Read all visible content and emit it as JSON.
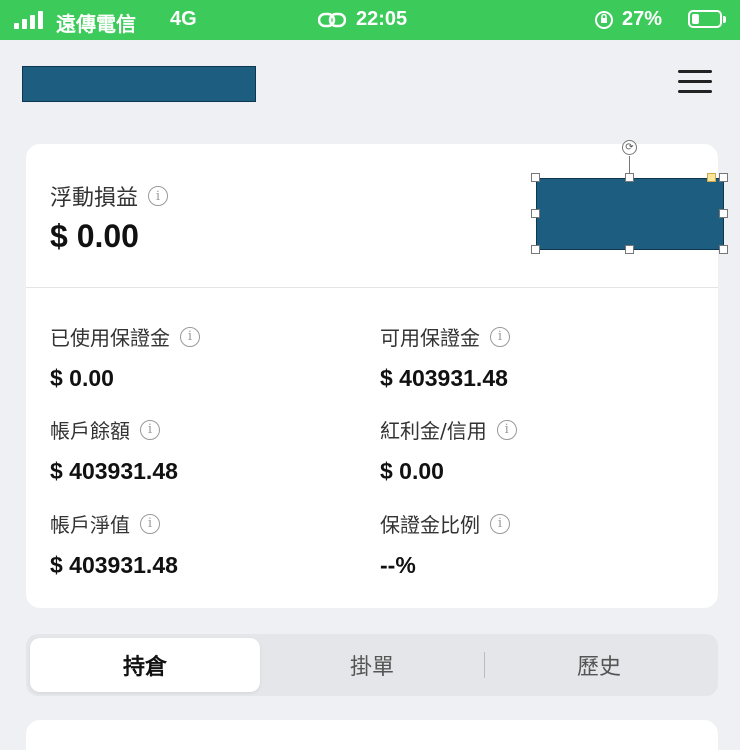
{
  "status_bar": {
    "carrier": "遠傳電信",
    "network": "4G",
    "time": "22:05",
    "battery": "27%",
    "battery_level": 0.27,
    "color": "#3ccb5a"
  },
  "header": {
    "menu_icon": "hamburger-menu-icon"
  },
  "floating_pl": {
    "label": "浮動損益",
    "value": "$ 0.00"
  },
  "metrics": [
    {
      "label": "已使用保證金",
      "value": "$ 0.00"
    },
    {
      "label": "可用保證金",
      "value": "$ 403931.48"
    },
    {
      "label": "帳戶餘額",
      "value": "$ 403931.48"
    },
    {
      "label": "紅利金/信用",
      "value": "$ 0.00"
    },
    {
      "label": "帳戶淨值",
      "value": "$ 403931.48"
    },
    {
      "label": "保證金比例",
      "value": "--%"
    }
  ],
  "info_symbol": "i",
  "tabs": [
    {
      "label": "持倉",
      "active": true
    },
    {
      "label": "掛單",
      "active": false
    },
    {
      "label": "歷史",
      "active": false
    }
  ],
  "colors": {
    "redaction": "#1d5e80",
    "page_background": "#eef0f3"
  }
}
